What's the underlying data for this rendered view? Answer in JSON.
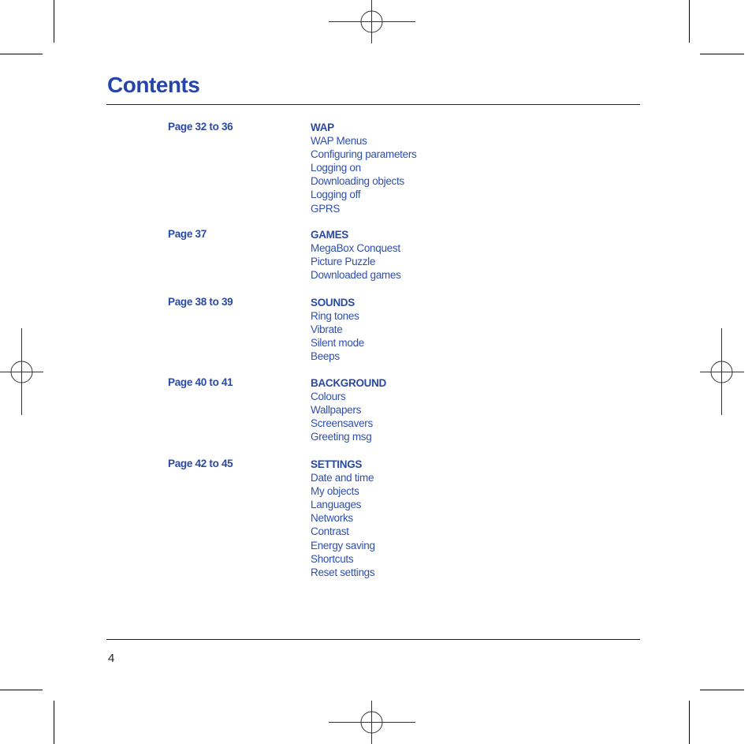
{
  "header": {
    "title": "Contents"
  },
  "sections": [
    {
      "page": "Page 32 to 36",
      "title": "WAP",
      "items": [
        "WAP Menus",
        "Configuring parameters",
        "Logging on",
        "Downloading objects",
        "Logging off",
        "GPRS"
      ]
    },
    {
      "page": "Page 37",
      "title": "GAMES",
      "items": [
        "MegaBox Conquest",
        "Picture Puzzle",
        "Downloaded games"
      ]
    },
    {
      "page": "Page 38 to 39",
      "title": "SOUNDS",
      "items": [
        "Ring tones",
        "Vibrate",
        "Silent mode",
        "Beeps"
      ]
    },
    {
      "page": "Page 40 to 41",
      "title": "BACKGROUND",
      "items": [
        "Colours",
        "Wallpapers",
        "Screensavers",
        "Greeting msg"
      ]
    },
    {
      "page": "Page 42 to 45",
      "title": "SETTINGS",
      "items": [
        "Date and time",
        "My objects",
        "Languages",
        "Networks",
        "Contrast",
        "Energy saving",
        "Shortcuts",
        "Reset settings"
      ]
    }
  ],
  "footer": {
    "page_number": "4"
  },
  "colors": {
    "heading_blue": "#2645a8",
    "text_blue": "#2f4fb0",
    "rule": "#222222"
  }
}
